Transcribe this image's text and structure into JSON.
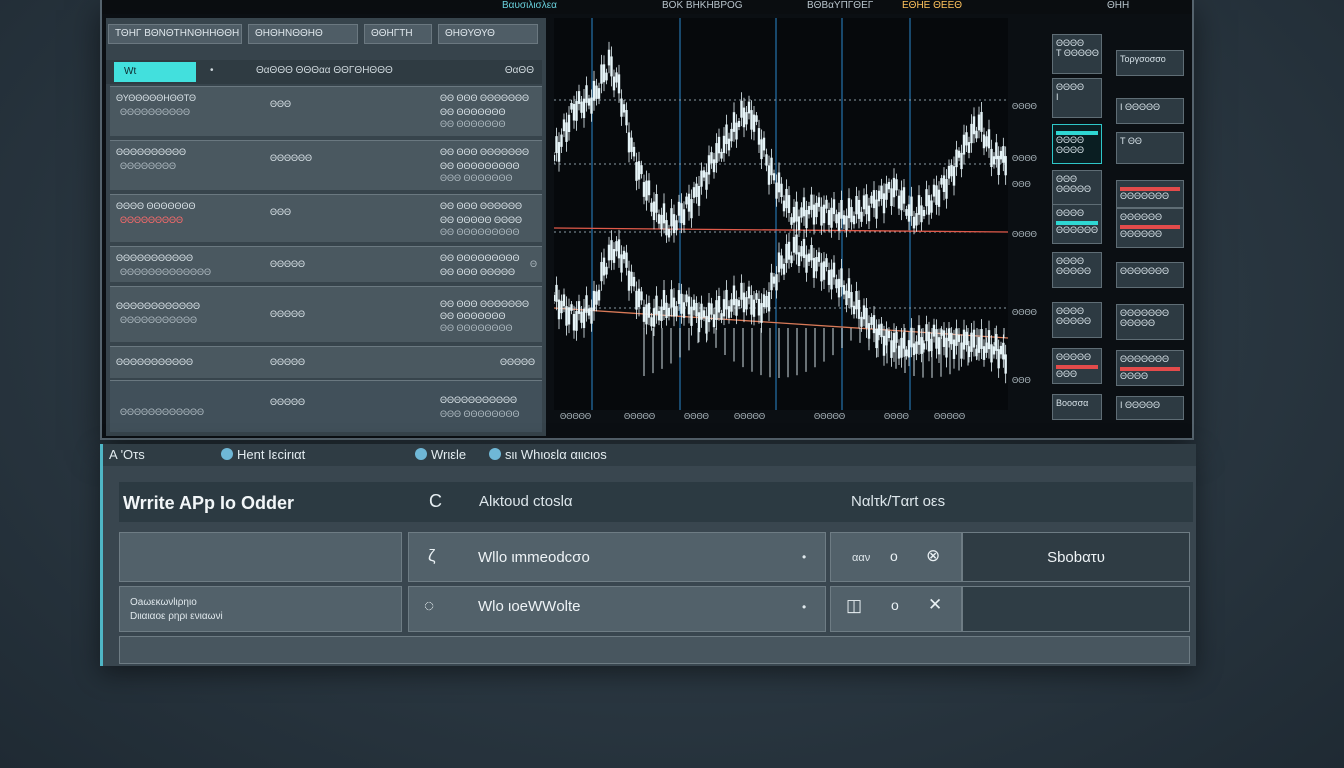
{
  "topbar": {
    "title": "Bαυσιλισλεα",
    "a": "BOK BHKHBPOG",
    "b": "BΘBαΥΠΓΘΕΓ",
    "c": "ΕΘΗΕ ΘΕΕΘ",
    "d": "ΘΗΗ"
  },
  "left": {
    "tabs": [
      "ΤΘΗΓ ΒΘΝΘΤΗΝΘΗΗΘΘΗ",
      "ΘΗΘΗΝΘΘΗΘ",
      "ΘΘΗΓΤΗ",
      "ΘΗΘΥΘΥΘ"
    ],
    "filter": {
      "search": "Wt",
      "dot": "•",
      "label": "ΘαΘΘΘ ΘΘΘαα ΘΘΓΘΗΘΘΘ",
      "right": "ΘαΘΘ"
    },
    "orders": [
      {
        "n1": "ΘΥΘΘΘΘΘΗΘΘΤΘ",
        "n2": "ΘΘΘΘΘΘΘΘΘΘ",
        "m": "ΘΘΘ",
        "r1": "ΘΘ ΘΘΘ ΘΘΘΘΘΘΘ",
        "r2": "ΘΘ  ΘΘΘΘΘΘΘ",
        "r3": "ΘΘ  ΘΘΘΘΘΘΘ"
      },
      {
        "n1": "ΘΘΘΘΘΘΘΘΘΘ",
        "n2": "ΘΘΘΘΘΘΘΘ",
        "m": "ΘΘΘΘΘΘ",
        "r1": "ΘΘ ΘΘΘ ΘΘΘΘΘΘΘ",
        "r2": "ΘΘ ΘΘΘΘΘΘΘΘΘ",
        "r3": "ΘΘΘ ΘΘΘΘΘΘΘ"
      },
      {
        "n1": "ΘΘΘΘ ΘΘΘΘΘΘΘ",
        "n2": "ΘΘΘΘΘΘΘΘΘ",
        "m": "ΘΘΘ",
        "r1": "ΘΘ ΘΘΘ ΘΘΘΘΘΘ",
        "r2": "ΘΘ ΘΘΘΘΘ ΘΘΘΘ",
        "r3": "ΘΘ ΘΘΘΘΘΘΘΘΘ"
      },
      {
        "n1": "ΘΘΘΘΘΘΘΘΘΘΘ",
        "n2": "ΘΘΘΘΘΘΘΘΘΘΘΘΘ",
        "m": "ΘΘΘΘΘ",
        "r1": "ΘΘ ΘΘΘΘΘΘΘΘΘ",
        "r2": "ΘΘ ΘΘΘ ΘΘΘΘΘ",
        "r3": "Θ"
      },
      {
        "n1": "ΘΘΘΘΘΘΘΘΘΘΘΘ",
        "n2": "ΘΘΘΘΘΘΘΘΘΘΘ",
        "m": "ΘΘΘΘΘ",
        "r1": "ΘΘ ΘΘΘ ΘΘΘΘΘΘΘ",
        "r2": "ΘΘ ΘΘΘΘΘΘΘ",
        "r3": "ΘΘ ΘΘΘΘΘΘΘΘ"
      },
      {
        "n1": "ΘΘΘΘΘΘΘΘΘΘΘ",
        "n2": "",
        "m": "ΘΘΘΘΘ",
        "r1": "",
        "r2": "ΘΘΘΘΘ",
        "r3": ""
      },
      {
        "n1": "",
        "n2": "ΘΘΘΘΘΘΘΘΘΘΘΘ",
        "m": "ΘΘΘΘΘ",
        "r1": "",
        "r2": "ΘΘΘΘΘΘΘΘΘΘΘ",
        "r3": "ΘΘΘ ΘΘΘΘΘΘΘΘ"
      }
    ]
  },
  "chart": {
    "price_labels": [
      "ΘΘΘΘ",
      "ΘΘΘΘ",
      "ΘΘΘ",
      "ΘΘΘΘ",
      "ΘΘΘΘ",
      "ΘΘΘ"
    ],
    "time_labels": [
      "ΘΘΘΘΘ",
      "ΘΘΘΘΘ",
      "ΘΘΘΘ",
      "ΘΘΘΘΘ",
      "ΘΘΘΘΘ",
      "ΘΘΘΘ",
      "ΘΘΘΘΘ"
    ],
    "colors": {
      "candle": "#e6f4f8",
      "grid": "#1f5d8b",
      "ma1": "#e05a4a",
      "ma2": "#d97a58",
      "dotted": "#8a9aa4"
    }
  },
  "widgets": {
    "left": [
      {
        "l1": "ΘΘΘΘ",
        "l2": "Τ ΘΘΘΘΘ"
      },
      {
        "l1": "ΘΘΘΘ",
        "l2": "Ι"
      },
      {
        "l1": "ΘΘΘΘ",
        "l2": "ΘΘΘΘ"
      },
      {
        "l1": "ΘΘΘ",
        "l2": "ΘΘΘΘΘ"
      },
      {
        "l1": "ΘΘΘΘ",
        "l2": "ΘΘΘΘΘΘ"
      },
      {
        "l1": "ΘΘΘΘ",
        "l2": "ΘΘΘΘΘ"
      },
      {
        "l1": "ΘΘΘΘ",
        "l2": "ΘΘΘΘΘ"
      },
      {
        "l1": "ΘΘΘΘΘ",
        "l2": "ΘΘΘ"
      },
      {
        "l1": "Βοοσσα",
        "l2": ""
      }
    ],
    "right": [
      {
        "l1": "Τοργσοσσο",
        "l2": ""
      },
      {
        "l1": "Ι ΘΘΘΘΘ",
        "l2": ""
      },
      {
        "l1": "Τ ΘΘ",
        "l2": ""
      },
      {
        "l1": "ΘΘΘΘΘΘΘ",
        "l2": ""
      },
      {
        "l1": "ΘΘΘΘΘΘ",
        "l2": "ΘΘΘΘΘΘ"
      },
      {
        "l1": "ΘΘΘΘΘΘΘ",
        "l2": ""
      },
      {
        "l1": "ΘΘΘΘΘΘΘ",
        "l2": "ΘΘΘΘΘ"
      },
      {
        "l1": "ΘΘΘΘΘΘΘ",
        "l2": "ΘΘΘΘ"
      },
      {
        "l1": "Ι ΘΘΘΘΘ",
        "l2": ""
      }
    ]
  },
  "lower": {
    "tabs": [
      "Α 'Οτs",
      "Ηent Ιεcirιαt",
      "Wrιεle",
      "sιι Whιοεlα αιιcιos"
    ],
    "header": {
      "title": "Wrrite APp Io Odder",
      "refresh_icon": "C",
      "col2": "Alκtουd ctοslα",
      "col3": "Nαlτk/Tαrt οεs"
    },
    "rows": [
      {
        "label": "",
        "icon": "ζ",
        "value": "Wllo ιmmeοdcσο",
        "dot": "•",
        "g1": "ααν",
        "g2": "ο",
        "g3": "⊗",
        "action": "Sbobατυ"
      },
      {
        "label": "Οaωεκωνlιρηιο",
        "label2": "Dιιαιαοε ρηρι ενιαωνi",
        "icon": "◌",
        "value": "Wlo ιoeWWοlte",
        "dot": "•",
        "g1": "◫",
        "g2": "ο",
        "g3": "✕",
        "action": ""
      }
    ]
  }
}
